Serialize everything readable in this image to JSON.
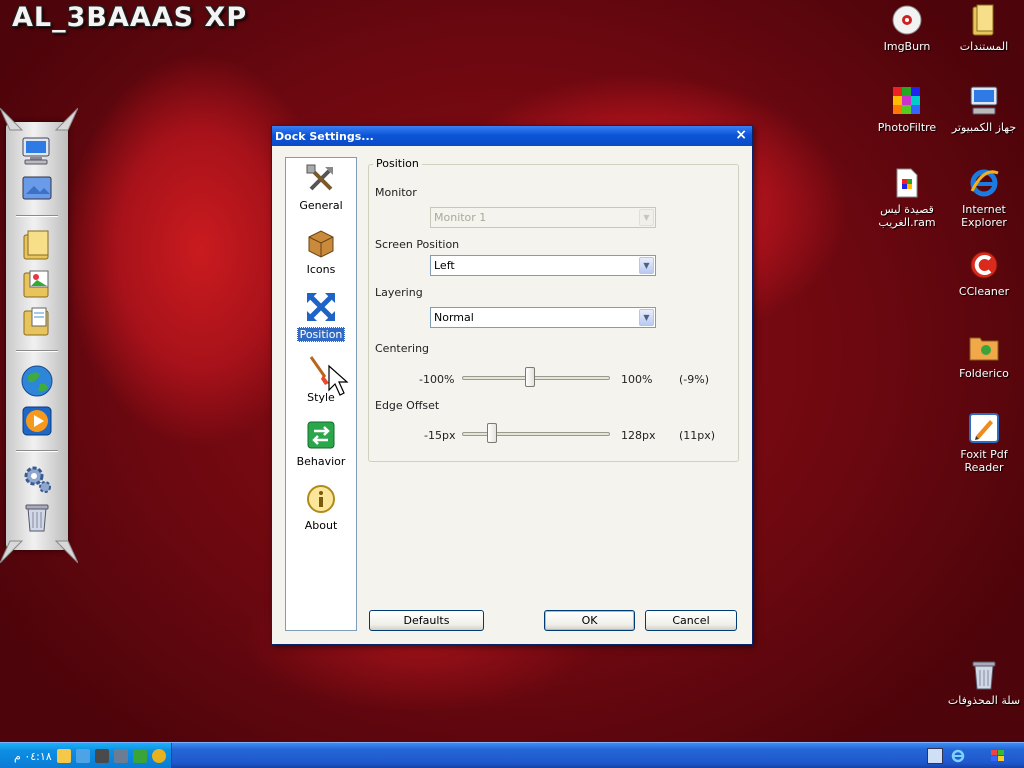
{
  "desktop": {
    "brand_text": "AL_3BAAAS XP"
  },
  "desktop_icons": [
    {
      "label": "المستندات",
      "icon": "folder-icon"
    },
    {
      "label": "ImgBurn",
      "icon": "disc-icon"
    },
    {
      "label": "جهاز الكمبيوتر",
      "icon": "computer-icon"
    },
    {
      "label": "PhotoFiltre",
      "icon": "palette-icon"
    },
    {
      "label": "Internet Explorer",
      "icon": "ie-icon"
    },
    {
      "label": "قصيدة ليس الغريب.ram",
      "icon": "media-file-icon"
    },
    {
      "label": "CCleaner",
      "icon": "ccleaner-icon"
    },
    {
      "label": "Folderico",
      "icon": "folder-color-icon"
    },
    {
      "label": "Foxit Pdf Reader",
      "icon": "pdf-icon"
    },
    {
      "label": "سلة المحذوفات",
      "icon": "recycle-bin-icon"
    }
  ],
  "dock_items": [
    {
      "icon": "my-computer-icon"
    },
    {
      "icon": "desktop-icon"
    },
    {
      "icon": "folder-icon"
    },
    {
      "icon": "pictures-folder-icon"
    },
    {
      "icon": "documents-folder-icon"
    },
    {
      "icon": "globe-icon"
    },
    {
      "icon": "media-player-icon"
    },
    {
      "icon": "settings-gear-icon"
    },
    {
      "icon": "recycle-bin-icon"
    }
  ],
  "dialog": {
    "title": "Dock Settings...",
    "close_glyph": "×",
    "nav": [
      {
        "label": "General",
        "icon": "tools-icon",
        "selected": false
      },
      {
        "label": "Icons",
        "icon": "box-icon",
        "selected": false
      },
      {
        "label": "Position",
        "icon": "position-arrows-icon",
        "selected": true
      },
      {
        "label": "Style",
        "icon": "paintbrush-icon",
        "selected": false
      },
      {
        "label": "Behavior",
        "icon": "behavior-arrows-icon",
        "selected": false
      },
      {
        "label": "About",
        "icon": "info-icon",
        "selected": false
      }
    ],
    "group_title": "Position",
    "monitor": {
      "label": "Monitor",
      "value": "Monitor 1",
      "disabled": true
    },
    "screen_position": {
      "label": "Screen Position",
      "value": "Left"
    },
    "layering": {
      "label": "Layering",
      "value": "Normal"
    },
    "centering": {
      "label": "Centering",
      "min_label": "-100%",
      "max_label": "100%",
      "value_label": "(-9%)",
      "value": -9,
      "min": -100,
      "max": 100
    },
    "edge_offset": {
      "label": "Edge Offset",
      "min_label": "-15px",
      "max_label": "128px",
      "value_label": "(11px)",
      "value": 11,
      "min": -15,
      "max": 128
    },
    "buttons": {
      "defaults": "Defaults",
      "ok": "OK",
      "cancel": "Cancel"
    }
  },
  "taskbar": {
    "clock": "٠٤:١٨ م"
  }
}
